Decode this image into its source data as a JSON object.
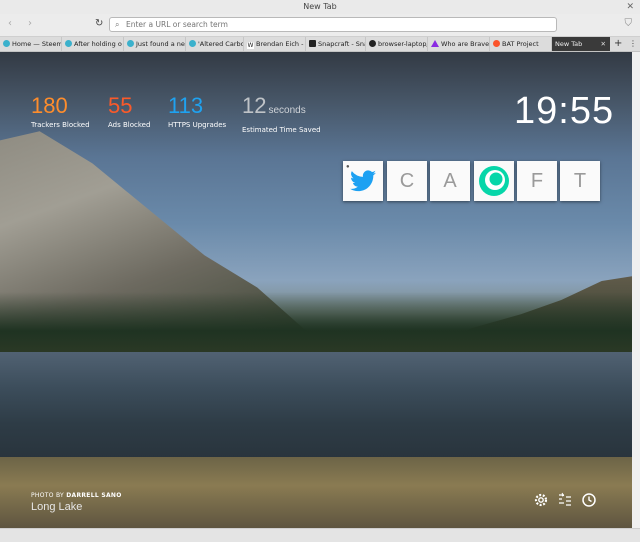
{
  "window": {
    "title": "New Tab"
  },
  "navbar": {
    "url_placeholder": "Enter a URL or search term"
  },
  "tabs": [
    {
      "label": "Home — Steem",
      "color": "#3bb1cc"
    },
    {
      "label": "After holding o",
      "color": "#3bb1cc"
    },
    {
      "label": "Just found a ne",
      "color": "#3bb1cc"
    },
    {
      "label": "'Altered Carbon",
      "color": "#3bb1cc"
    },
    {
      "label": "Brendan Eich - V",
      "color": "#ffffff"
    },
    {
      "label": "Snapcraft - Snap",
      "color": "#222222"
    },
    {
      "label": "browser-laptop/",
      "color": "#222222"
    },
    {
      "label": "Who are Brave/",
      "color": "#8a2be2"
    },
    {
      "label": "BAT Project",
      "color": "#fb542b"
    },
    {
      "label": "New Tab",
      "color": ""
    }
  ],
  "stats": {
    "trackers": {
      "value": "180",
      "label": "Trackers Blocked",
      "color": "#fe8d2c"
    },
    "ads": {
      "value": "55",
      "label": "Ads Blocked",
      "color": "#fa5a2a"
    },
    "https": {
      "value": "113",
      "label": "HTTPS Upgrades",
      "color": "#1fa2f0"
    },
    "time": {
      "value": "12",
      "unit": "seconds",
      "label": "Estimated Time Saved",
      "color": "#bfc3c7"
    }
  },
  "clock": "19:55",
  "top_sites": [
    {
      "letter": "",
      "icon": "twitter-icon"
    },
    {
      "letter": "C"
    },
    {
      "letter": "A"
    },
    {
      "letter": "",
      "icon": "steemit-icon"
    },
    {
      "letter": "F"
    },
    {
      "letter": "T"
    }
  ],
  "credit": {
    "prefix": "PHOTO BY",
    "author": "DARRELL SANO",
    "place": "Long Lake"
  },
  "bottom_icons": [
    "settings-icon",
    "bookmarks-icon",
    "history-icon"
  ]
}
